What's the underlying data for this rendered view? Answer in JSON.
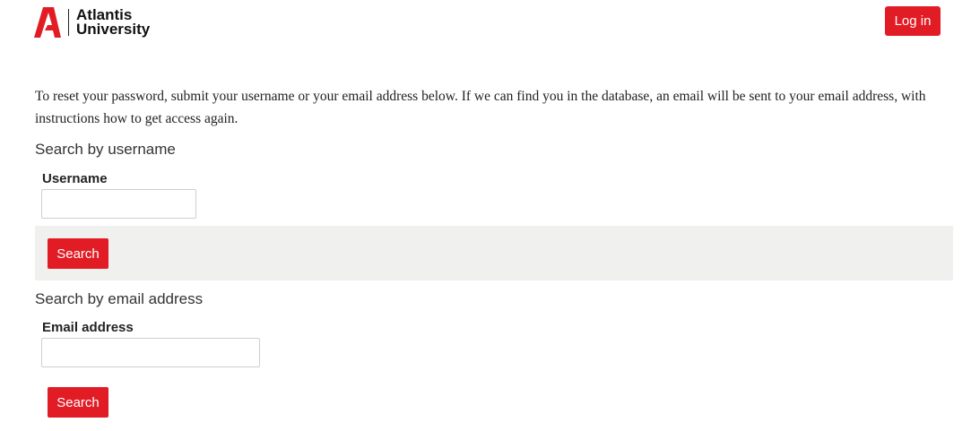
{
  "header": {
    "logo_line1": "Atlantis",
    "logo_line2": "University",
    "login_label": "Log in"
  },
  "intro": {
    "text": "To reset your password, submit your username or your email address below. If we can find you in the database, an email will be sent to your email address, with instructions how to get access again."
  },
  "username_section": {
    "title": "Search by username",
    "field_label": "Username",
    "value": "",
    "search_label": "Search"
  },
  "email_section": {
    "title": "Search by email address",
    "field_label": "Email address",
    "value": "",
    "search_label": "Search"
  },
  "colors": {
    "brand_red": "#e21c24",
    "action_bar": "#f0f0ee"
  }
}
